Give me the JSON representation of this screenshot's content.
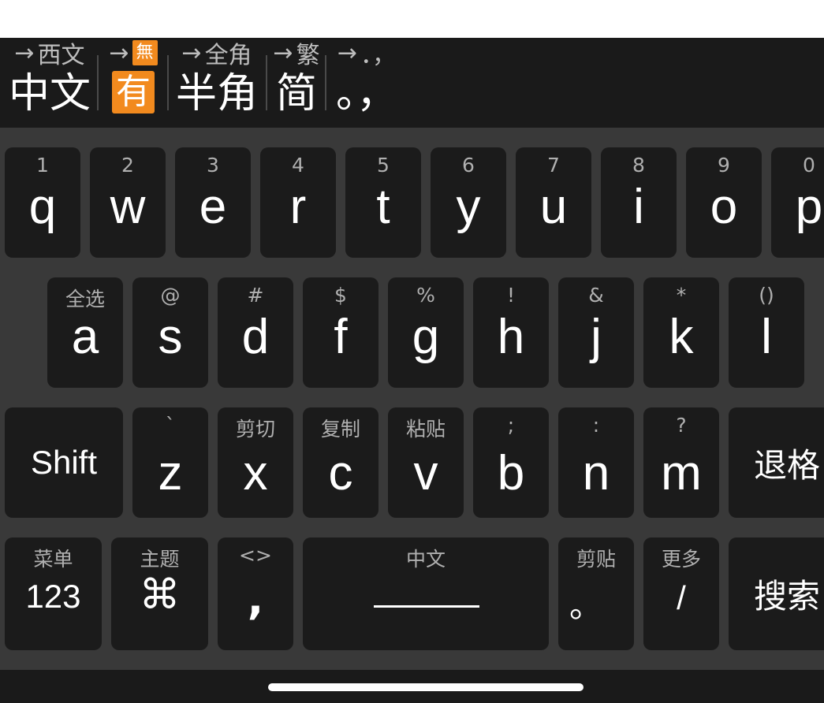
{
  "status_bar": {
    "toggles": [
      {
        "next": "西文",
        "current": "中文"
      },
      {
        "next": "無",
        "current": "有"
      },
      {
        "next": "全角",
        "current": "半角"
      },
      {
        "next": "繁",
        "current": "简"
      },
      {
        "next": "．，",
        "current": "。，"
      }
    ],
    "arrow": "→",
    "badge_color": "#f28a1e"
  },
  "keyboard": {
    "row1": [
      {
        "hint": "1",
        "main": "q"
      },
      {
        "hint": "2",
        "main": "w"
      },
      {
        "hint": "3",
        "main": "e"
      },
      {
        "hint": "4",
        "main": "r"
      },
      {
        "hint": "5",
        "main": "t"
      },
      {
        "hint": "6",
        "main": "y"
      },
      {
        "hint": "7",
        "main": "u"
      },
      {
        "hint": "8",
        "main": "i"
      },
      {
        "hint": "9",
        "main": "o"
      },
      {
        "hint": "0",
        "main": "p"
      }
    ],
    "row2": [
      {
        "hint": "全选",
        "main": "a"
      },
      {
        "hint": "@",
        "main": "s"
      },
      {
        "hint": "#",
        "main": "d"
      },
      {
        "hint": "$",
        "main": "f"
      },
      {
        "hint": "%",
        "main": "g"
      },
      {
        "hint": "!",
        "main": "h"
      },
      {
        "hint": "&",
        "main": "j"
      },
      {
        "hint": "*",
        "main": "k"
      },
      {
        "hint": "()",
        "main": "l"
      }
    ],
    "row3": {
      "shift": "Shift",
      "keys": [
        {
          "hint": "`",
          "main": "z"
        },
        {
          "hint": "剪切",
          "main": "x"
        },
        {
          "hint": "复制",
          "main": "c"
        },
        {
          "hint": "粘贴",
          "main": "v"
        },
        {
          "hint": ";",
          "main": "b"
        },
        {
          "hint": ":",
          "main": "n"
        },
        {
          "hint": "?",
          "main": "m"
        }
      ],
      "backspace": "退格"
    },
    "row4": {
      "menu": {
        "hint": "菜单",
        "main": "123"
      },
      "theme": {
        "hint": "主题",
        "main": "⌘"
      },
      "comma": {
        "hint": "<>",
        "main": ","
      },
      "space": {
        "hint": "中文"
      },
      "period": {
        "hint": "剪贴",
        "main": "。"
      },
      "slash": {
        "hint": "更多",
        "main": "/"
      },
      "search": "搜索"
    }
  },
  "colors": {
    "key_bg": "#1b1b1b",
    "keyboard_bg": "#393939",
    "hint_text": "#b0b0b0"
  }
}
